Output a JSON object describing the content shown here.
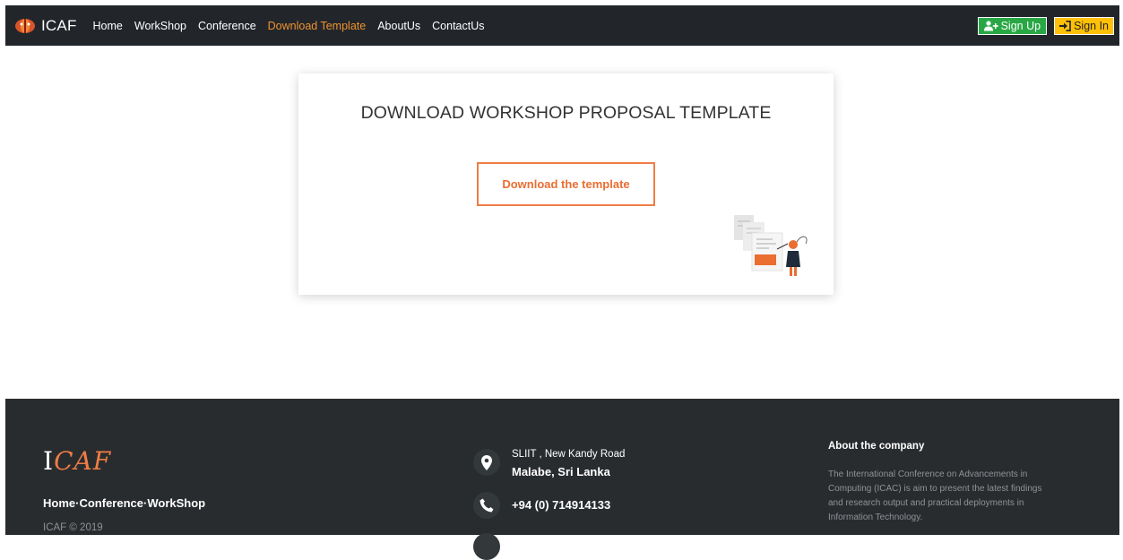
{
  "nav": {
    "brand": "ICAF",
    "items": [
      {
        "label": "Home",
        "active": false
      },
      {
        "label": "WorkShop",
        "active": false
      },
      {
        "label": "Conference",
        "active": false
      },
      {
        "label": "Download Template",
        "active": true
      },
      {
        "label": "AboutUs",
        "active": false
      },
      {
        "label": "ContactUs",
        "active": false
      }
    ],
    "signup_label": "Sign Up",
    "signin_label": "Sign In"
  },
  "main": {
    "title": "DOWNLOAD WORKSHOP PROPOSAL TEMPLATE",
    "download_label": "Download the template"
  },
  "footer": {
    "logo_first": "I",
    "logo_rest": "CAF",
    "links": [
      "Home",
      "Conference",
      "WorkShop"
    ],
    "link_separator": "·",
    "copyright": "ICAF © 2019",
    "address_line1": "SLIIT , New Kandy Road",
    "address_line2": "Malabe, Sri Lanka",
    "phone": "+94 (0) 714914133",
    "about_title": "About the company",
    "about_text": "The International Conference on Advancements in Computing (ICAC) is aim to present the latest findings and research output and practical deployments in Information Technology."
  },
  "colors": {
    "navbar": "#22262b",
    "accent": "#ef7d45",
    "active_link": "#f0922e",
    "signup": "#29a745",
    "signin": "#ffc107",
    "footer": "#292c2f"
  },
  "icons": {
    "brand": "icaf-logo-icon",
    "signup": "user-plus-icon",
    "signin": "sign-in-icon",
    "address": "map-marker-icon",
    "phone": "phone-icon"
  }
}
